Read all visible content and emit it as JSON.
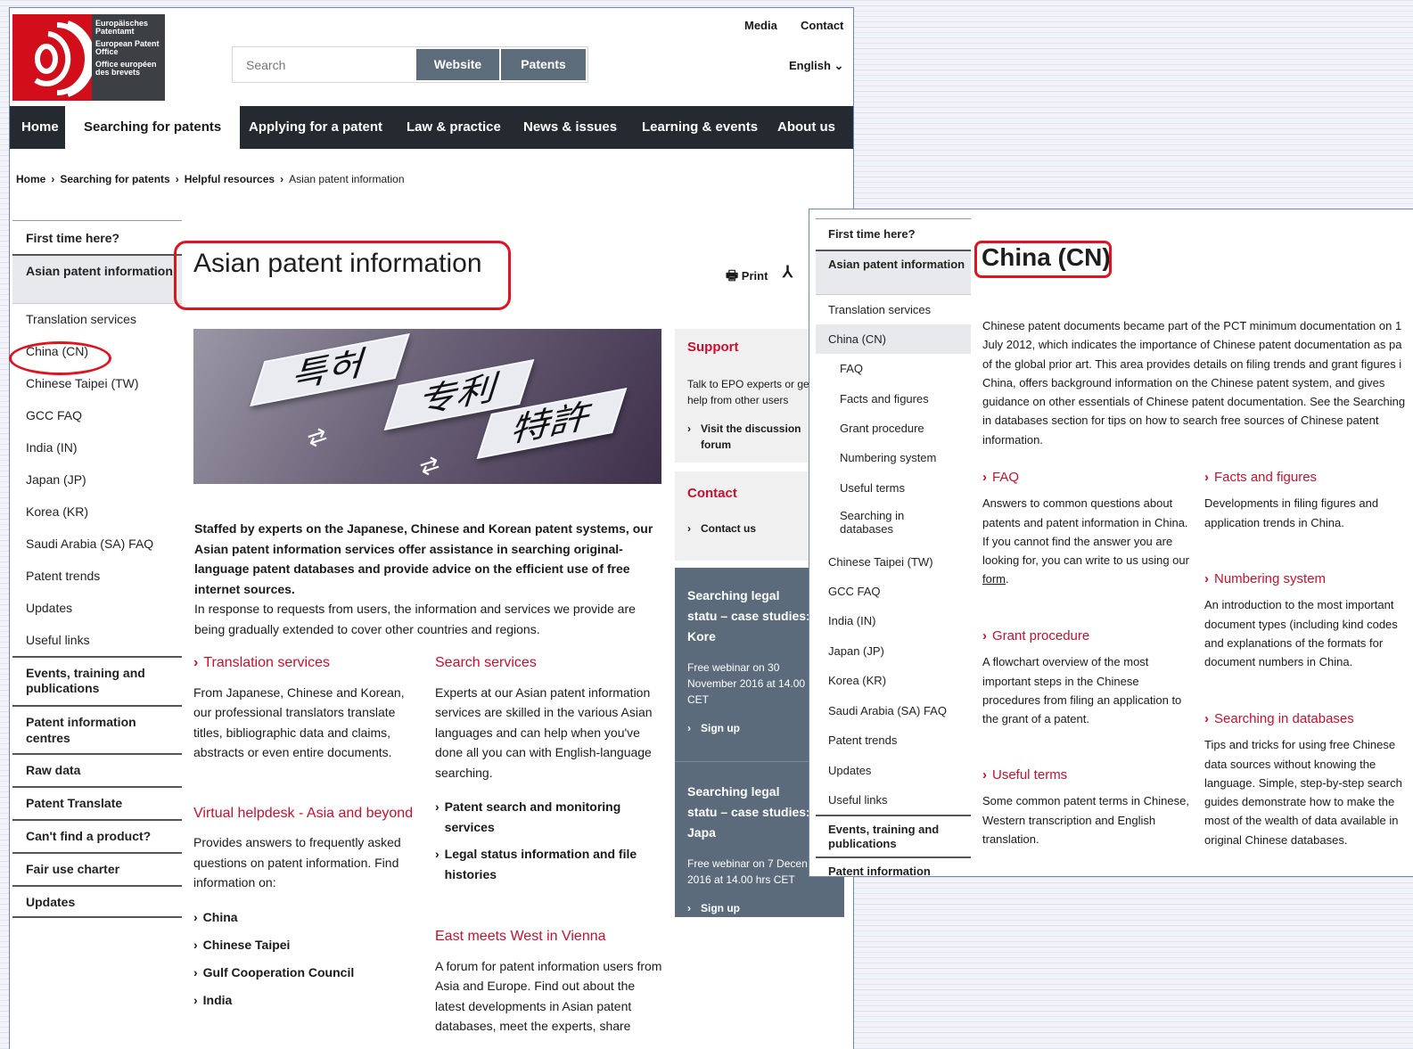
{
  "logo": {
    "line1": "Europäisches Patentamt",
    "line2": "European Patent Office",
    "line3": "Office européen des brevets"
  },
  "header": {
    "media": "Media",
    "contact": "Contact",
    "language": "English ⌄",
    "search_placeholder": "Search",
    "website": "Website",
    "patents": "Patents"
  },
  "nav": [
    "Home",
    "Searching for patents",
    "Applying for a patent",
    "Law & practice",
    "News & issues",
    "Learning & events",
    "About us"
  ],
  "breadcrumb": [
    "Home",
    "Searching for patents",
    "Helpful resources",
    "Asian patent information"
  ],
  "sidebar1": {
    "first": "First time here?",
    "asian": "Asian patent information",
    "translation": "Translation services",
    "china": "China (CN)",
    "taipei": "Chinese Taipei (TW)",
    "gcc": "GCC FAQ",
    "india": "India (IN)",
    "japan": "Japan (JP)",
    "korea": "Korea (KR)",
    "saudi": "Saudi Arabia (SA) FAQ",
    "trends": "Patent trends",
    "updates": "Updates",
    "links": "Useful links",
    "events": "Events, training and publications",
    "pic": "Patent information centres",
    "raw": "Raw data",
    "translate": "Patent Translate",
    "cantfind": "Can't find a product?",
    "fairuse": "Fair use charter",
    "updates2": "Updates"
  },
  "page1": {
    "title": "Asian patent information",
    "print": "Print",
    "hero_text": {
      "a": "특허",
      "b": "专利",
      "c": "特許"
    },
    "intro_bold": "Staffed by experts on the Japanese, Chinese and Korean patent systems, our Asian patent information services offer assistance in searching original-language patent databases and provide advice on the efficient use of free internet sources.",
    "intro": "In response to requests from users, the information and services we provide are being gradually extended to cover other countries and regions.",
    "translation_h": "Translation services",
    "translation_p": "From Japanese, Chinese and Korean, our professional translators translate titles, bibliographic data and claims, abstracts or even entire documents.",
    "helpdesk_h": "Virtual helpdesk - Asia and beyond",
    "helpdesk_p": "Provides answers to frequently asked questions on patent information. Find information on:",
    "helpdesk_list": [
      "China",
      "Chinese Taipei",
      "Gulf Cooperation Council",
      "India"
    ],
    "search_h": "Search services",
    "search_p": "Experts at our Asian patent information services are skilled in the various Asian languages and can help when you've done all you can with English-language searching.",
    "search_link1": "Patent search and monitoring services",
    "search_link2": "Legal status information and file histories",
    "east_h": "East meets West in Vienna",
    "east_p": "A forum for patent information users from Asia and Europe. Find out about the latest developments in Asian patent databases, meet the experts, share"
  },
  "rail": {
    "support_h": "Support",
    "support_p": "Talk to EPO experts or ge help from other users",
    "discussion": "Visit the discussion forum",
    "contact_h": "Contact",
    "contact_us": "Contact us",
    "webinar1_h": "Searching legal statu – case studies: Kore",
    "webinar1_p": "Free webinar on 30 November 2016 at 14.00 CET",
    "signup1": "Sign up",
    "webinar2_h": "Searching legal statu – case studies: Japa",
    "webinar2_p": "Free webinar on 7 Decen 2016 at 14.00 hrs CET",
    "signup2": "Sign up"
  },
  "sidebar2": {
    "first": "First time here?",
    "asian": "Asian patent information",
    "translation": "Translation services",
    "china": "China (CN)",
    "faq": "FAQ",
    "facts": "Facts and figures",
    "grant": "Grant procedure",
    "numbering": "Numbering system",
    "terms": "Useful terms",
    "searching": "Searching in databases",
    "taipei": "Chinese Taipei (TW)",
    "gcc": "GCC FAQ",
    "india": "India (IN)",
    "japan": "Japan (JP)",
    "korea": "Korea (KR)",
    "saudi": "Saudi Arabia (SA) FAQ",
    "trends": "Patent trends",
    "updates": "Updates",
    "links": "Useful links",
    "events": "Events, training and publications",
    "pic": "Patent information"
  },
  "page2": {
    "title": "China (CN)",
    "intro": "Chinese patent documents became part of the PCT minimum documentation on 1 July 2012, which indicates the importance of Chinese patent documentation as pa of the global prior art. This area provides details on filing trends and grant figures i China, offers background information on the Chinese patent system, and gives guidance on other essentials of Chinese patent documentation. See the Searching in databases section for tips on how to search free sources of Chinese patent information.",
    "faq_h": "FAQ",
    "faq_p": "Answers to common questions about patents and patent information in China. If you cannot find the answer you are looking for, you can write to us using our",
    "faq_link": "form",
    "grant_h": "Grant procedure",
    "grant_p": "A flowchart overview of the most important steps in the Chinese procedures from filing an application to the grant of a patent.",
    "terms_h": "Useful terms",
    "terms_p": "Some common patent terms in Chinese, Western transcription and English translation.",
    "facts_h": "Facts and figures",
    "facts_p": "Developments in filing figures and application trends in China.",
    "numbering_h": "Numbering system",
    "numbering_p": "An introduction to the most important document types (including kind codes and explanations of the formats for document numbers in China.",
    "searching_h": "Searching in databases",
    "searching_p": "Tips and tricks for using free Chinese data sources without knowing the language. Simple, step-by-step search guides demonstrate how to make the most of the wealth of data available in original Chinese databases."
  }
}
